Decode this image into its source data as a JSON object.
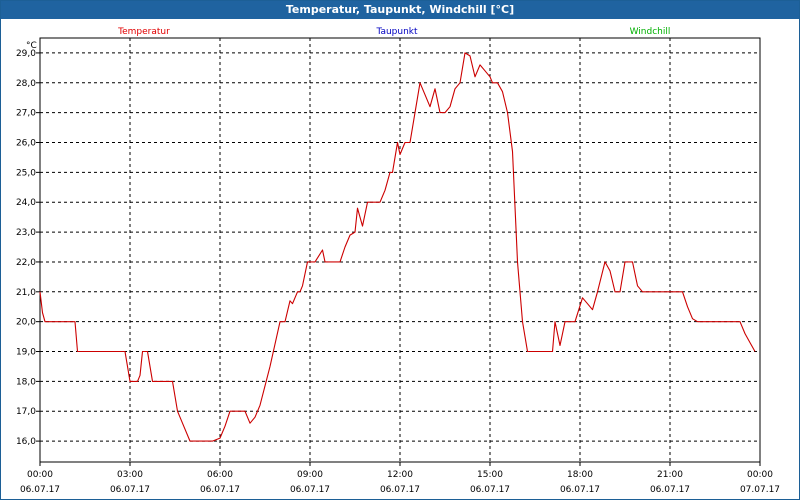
{
  "window": {
    "title": "Temperatur, Taupunkt, Windchill [°C]"
  },
  "chart_data": {
    "type": "line",
    "title": "Temperatur, Taupunkt, Windchill [°C]",
    "ylabel": "°C",
    "xlabel": "",
    "ylim": [
      15.3,
      29.5
    ],
    "xlim": [
      "06.07.17 00:00",
      "07.07.17 00:00"
    ],
    "grid": true,
    "legend_placement": "top",
    "y_ticks": [
      "16,0",
      "17,0",
      "18,0",
      "19,0",
      "20,0",
      "21,0",
      "22,0",
      "23,0",
      "24,0",
      "25,0",
      "26,0",
      "27,0",
      "28,0",
      "29,0"
    ],
    "x_ticks": [
      {
        "time": "00:00",
        "date": "06.07.17"
      },
      {
        "time": "03:00",
        "date": "06.07.17"
      },
      {
        "time": "06:00",
        "date": "06.07.17"
      },
      {
        "time": "09:00",
        "date": "06.07.17"
      },
      {
        "time": "12:00",
        "date": "06.07.17"
      },
      {
        "time": "15:00",
        "date": "06.07.17"
      },
      {
        "time": "18:00",
        "date": "06.07.17"
      },
      {
        "time": "21:00",
        "date": "06.07.17"
      },
      {
        "time": "00:00",
        "date": "07.07.17"
      }
    ],
    "legend": [
      {
        "label": "Temperatur",
        "color": "#e00000"
      },
      {
        "label": "Taupunkt",
        "color": "#0000c0"
      },
      {
        "label": "Windchill",
        "color": "#00b000"
      }
    ],
    "series": [
      {
        "name": "Temperatur",
        "color": "#cc0000",
        "points": [
          [
            "00:00",
            21.0
          ],
          [
            "00:05",
            20.3
          ],
          [
            "00:10",
            20.0
          ],
          [
            "00:20",
            20.0
          ],
          [
            "00:40",
            20.0
          ],
          [
            "01:10",
            20.0
          ],
          [
            "01:15",
            19.0
          ],
          [
            "02:50",
            19.0
          ],
          [
            "03:00",
            18.0
          ],
          [
            "03:15",
            18.0
          ],
          [
            "03:20",
            18.2
          ],
          [
            "03:25",
            19.0
          ],
          [
            "03:35",
            19.0
          ],
          [
            "03:45",
            18.0
          ],
          [
            "04:10",
            18.0
          ],
          [
            "04:25",
            18.0
          ],
          [
            "04:35",
            17.0
          ],
          [
            "04:45",
            16.6
          ],
          [
            "05:00",
            16.0
          ],
          [
            "05:15",
            16.0
          ],
          [
            "05:45",
            16.0
          ],
          [
            "06:00",
            16.1
          ],
          [
            "06:10",
            16.5
          ],
          [
            "06:20",
            17.0
          ],
          [
            "06:50",
            17.0
          ],
          [
            "07:00",
            16.6
          ],
          [
            "07:10",
            16.8
          ],
          [
            "07:20",
            17.2
          ],
          [
            "07:40",
            18.5
          ],
          [
            "08:00",
            20.0
          ],
          [
            "08:10",
            20.0
          ],
          [
            "08:20",
            20.7
          ],
          [
            "08:25",
            20.6
          ],
          [
            "08:35",
            21.0
          ],
          [
            "08:40",
            21.0
          ],
          [
            "08:45",
            21.2
          ],
          [
            "08:55",
            22.0
          ],
          [
            "09:00",
            22.0
          ],
          [
            "09:10",
            22.0
          ],
          [
            "09:25",
            22.4
          ],
          [
            "09:30",
            22.0
          ],
          [
            "09:40",
            22.0
          ],
          [
            "10:00",
            22.0
          ],
          [
            "10:10",
            22.5
          ],
          [
            "10:20",
            22.9
          ],
          [
            "10:30",
            23.0
          ],
          [
            "10:35",
            23.8
          ],
          [
            "10:45",
            23.2
          ],
          [
            "10:55",
            24.0
          ],
          [
            "11:05",
            24.0
          ],
          [
            "11:20",
            24.0
          ],
          [
            "11:30",
            24.4
          ],
          [
            "11:40",
            25.0
          ],
          [
            "11:45",
            25.0
          ],
          [
            "11:55",
            26.0
          ],
          [
            "12:00",
            25.6
          ],
          [
            "12:10",
            26.0
          ],
          [
            "12:20",
            26.0
          ],
          [
            "12:30",
            27.0
          ],
          [
            "12:40",
            28.0
          ],
          [
            "12:50",
            27.6
          ],
          [
            "13:00",
            27.2
          ],
          [
            "13:10",
            27.8
          ],
          [
            "13:20",
            27.0
          ],
          [
            "13:30",
            27.0
          ],
          [
            "13:40",
            27.2
          ],
          [
            "13:50",
            27.8
          ],
          [
            "14:00",
            28.0
          ],
          [
            "14:10",
            29.0
          ],
          [
            "14:20",
            28.9
          ],
          [
            "14:30",
            28.2
          ],
          [
            "14:40",
            28.6
          ],
          [
            "14:50",
            28.4
          ],
          [
            "15:00",
            28.2
          ],
          [
            "15:05",
            28.0
          ],
          [
            "15:15",
            28.0
          ],
          [
            "15:25",
            27.7
          ],
          [
            "15:35",
            27.0
          ],
          [
            "15:45",
            25.7
          ],
          [
            "15:55",
            22.0
          ],
          [
            "16:05",
            20.0
          ],
          [
            "16:15",
            19.0
          ],
          [
            "16:50",
            19.0
          ],
          [
            "17:05",
            19.0
          ],
          [
            "17:10",
            20.0
          ],
          [
            "17:20",
            19.2
          ],
          [
            "17:30",
            20.0
          ],
          [
            "17:50",
            20.0
          ],
          [
            "18:05",
            20.8
          ],
          [
            "18:15",
            20.6
          ],
          [
            "18:25",
            20.4
          ],
          [
            "18:35",
            21.0
          ],
          [
            "18:50",
            22.0
          ],
          [
            "19:00",
            21.7
          ],
          [
            "19:10",
            21.0
          ],
          [
            "19:20",
            21.0
          ],
          [
            "19:30",
            22.0
          ],
          [
            "19:45",
            22.0
          ],
          [
            "19:55",
            21.2
          ],
          [
            "20:05",
            21.0
          ],
          [
            "20:30",
            21.0
          ],
          [
            "21:10",
            21.0
          ],
          [
            "21:25",
            21.0
          ],
          [
            "21:35",
            20.5
          ],
          [
            "21:45",
            20.1
          ],
          [
            "21:55",
            20.0
          ],
          [
            "22:30",
            20.0
          ],
          [
            "23:20",
            20.0
          ],
          [
            "23:30",
            19.6
          ],
          [
            "23:40",
            19.3
          ],
          [
            "23:50",
            19.0
          ]
        ]
      }
    ]
  }
}
